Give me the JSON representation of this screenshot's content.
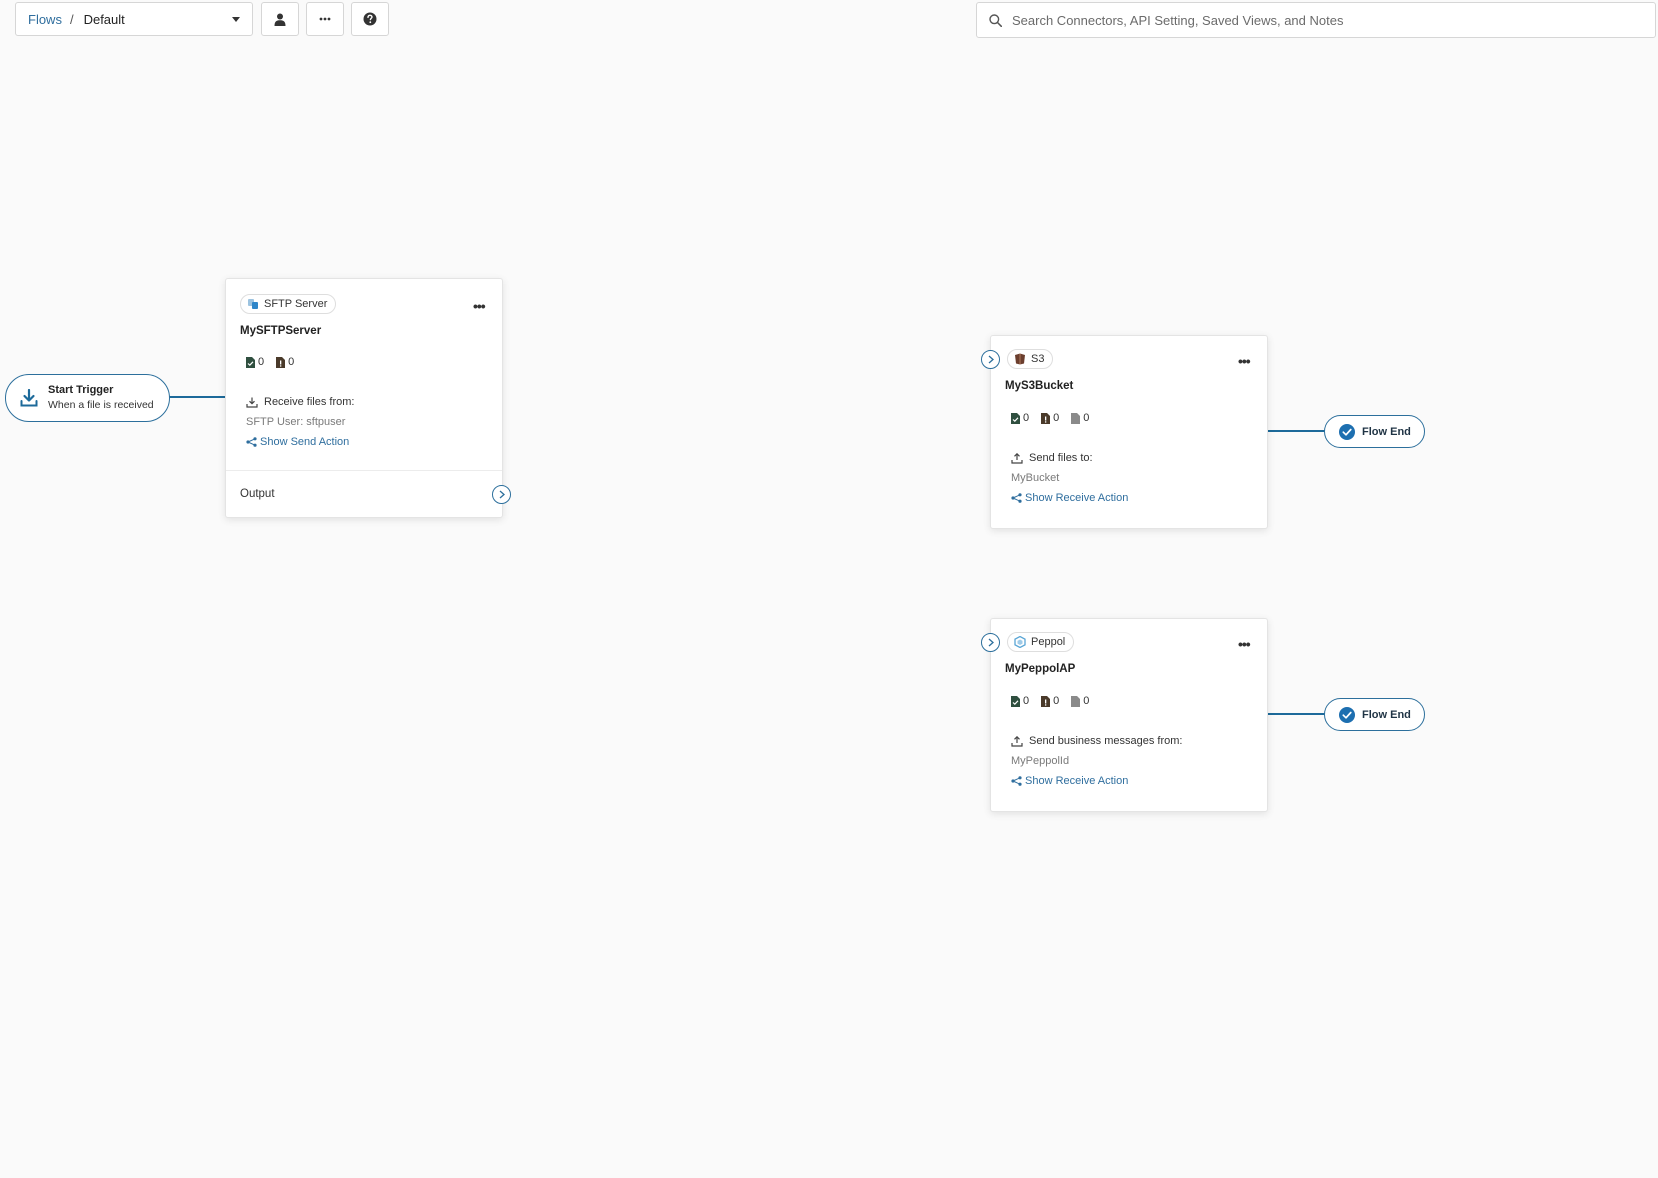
{
  "toolbar": {
    "breadcrumb_root": "Flows",
    "breadcrumb_separator": "/",
    "breadcrumb_current": "Default",
    "user_icon": "user-icon",
    "more_icon": "ellipsis-icon",
    "help_icon": "help-circle-icon",
    "search_placeholder": "Search Connectors, API Setting, Saved Views, and Notes"
  },
  "start_trigger": {
    "title": "Start Trigger",
    "subtitle": "When a file is received",
    "icon": "download-icon"
  },
  "cards": {
    "sftp": {
      "type_label": "SFTP Server",
      "name": "MySFTPServer",
      "stats": [
        "0",
        "0"
      ],
      "action_label": "Receive files from:",
      "action_value": "SFTP User: sftpuser",
      "show_link": "Show Send Action",
      "output_label": "Output"
    },
    "s3": {
      "type_label": "S3",
      "name": "MyS3Bucket",
      "stats": [
        "0",
        "0",
        "0"
      ],
      "action_label": "Send files to:",
      "action_value": "MyBucket",
      "show_link": "Show Receive Action"
    },
    "peppol": {
      "type_label": "Peppol",
      "name": "MyPeppolAP",
      "stats": [
        "0",
        "0",
        "0"
      ],
      "action_label": "Send business messages from:",
      "action_value": "MyPeppolId",
      "show_link": "Show Receive Action"
    }
  },
  "flow_end": {
    "label": "Flow End"
  },
  "colors": {
    "accent": "#1d6a9a",
    "link": "#2f6e9e",
    "background": "#fafafa"
  }
}
